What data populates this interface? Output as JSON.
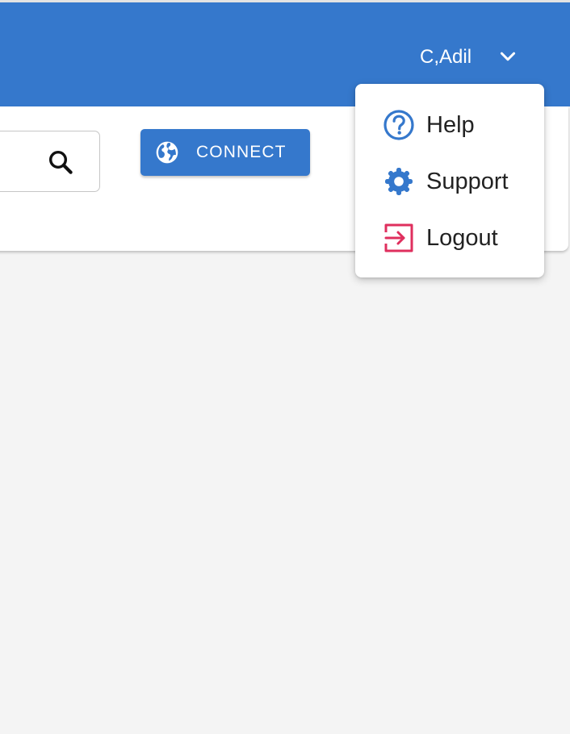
{
  "header": {
    "background_color": "#3578cc",
    "user_menu": {
      "name": "C,Adil",
      "icon": "chevron-down-icon"
    }
  },
  "toolbar": {
    "search_icon": "search-icon",
    "connect_button": {
      "label": "CONNECT",
      "icon": "globe-icon",
      "color": "#3578cc"
    }
  },
  "dropdown": {
    "items": [
      {
        "label": "Help",
        "icon": "help-circle-icon",
        "color": "#3578cc"
      },
      {
        "label": "Support",
        "icon": "gear-icon",
        "color": "#3578cc"
      },
      {
        "label": "Logout",
        "icon": "logout-icon",
        "color": "#df2f5e"
      }
    ]
  }
}
